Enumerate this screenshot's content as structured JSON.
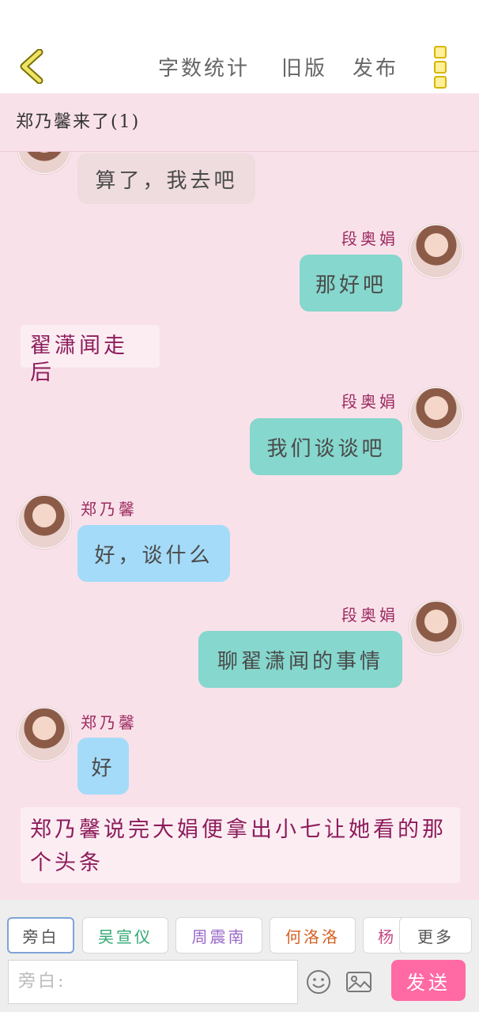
{
  "header": {
    "actions": [
      "字数统计",
      "旧版",
      "发布"
    ]
  },
  "notice": "郑乃馨来了(1)",
  "messages": [
    {
      "speaker": "",
      "text": "算了，我去吧",
      "side": "left"
    },
    {
      "speaker": "段奥娟",
      "text": "那好吧",
      "side": "right"
    },
    {
      "speaker": "",
      "text": "翟潇闻走后",
      "side": "narration"
    },
    {
      "speaker": "段奥娟",
      "text": "我们谈谈吧",
      "side": "right"
    },
    {
      "speaker": "郑乃馨",
      "text": "好，谈什么",
      "side": "left"
    },
    {
      "speaker": "段奥娟",
      "text": "聊翟潇闻的事情",
      "side": "right"
    },
    {
      "speaker": "郑乃馨",
      "text": "好",
      "side": "left"
    },
    {
      "speaker": "",
      "text": "郑乃馨说完大娟便拿出小七让她看的那个头条",
      "side": "narration"
    }
  ],
  "roles": [
    {
      "label": "旁白",
      "color": "#555555"
    },
    {
      "label": "吴宣仪",
      "color": "#2fa871"
    },
    {
      "label": "周震南",
      "color": "#9a68c8"
    },
    {
      "label": "何洛洛",
      "color": "#d46020"
    },
    {
      "label": "杨",
      "color": "#c44b86"
    }
  ],
  "more_label": "更多",
  "input_placeholder": "旁白:",
  "send_label": "发送",
  "colors": {
    "accent_pink": "#ff6aa5",
    "bubble_green": "#86d7cd",
    "bubble_blue": "#a4dbf8",
    "narration_text": "#8d1c5c",
    "background": "#f9e1ea"
  },
  "icons": [
    "back-arrow-icon",
    "more-vertical-icon",
    "emoji-icon",
    "image-icon"
  ]
}
